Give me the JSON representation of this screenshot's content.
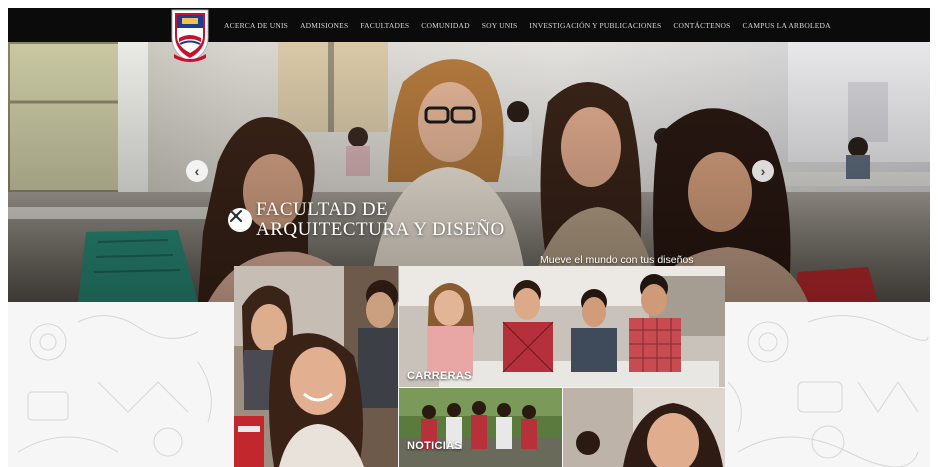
{
  "nav": {
    "items": [
      "ACERCA DE UNIS",
      "ADMISIONES",
      "FACULTADES",
      "COMUNIDAD",
      "SOY UNIS",
      "INVESTIGACIÓN Y PUBLICACIONES",
      "CONTÁCTENOS",
      "CAMPUS LA ARBOLEDA"
    ]
  },
  "hero": {
    "title_line1": "FACULTAD DE",
    "title_line2": "ARQUITECTURA Y DISEÑO",
    "subtitle": "Mueve el mundo con tus diseños"
  },
  "tiles": {
    "carreras_label": "CARRERAS",
    "noticias_label": "NOTICIAS"
  },
  "colors": {
    "navbar": "#0b0b0b",
    "logo_red": "#c8102e",
    "logo_blue": "#1b3d8f"
  }
}
